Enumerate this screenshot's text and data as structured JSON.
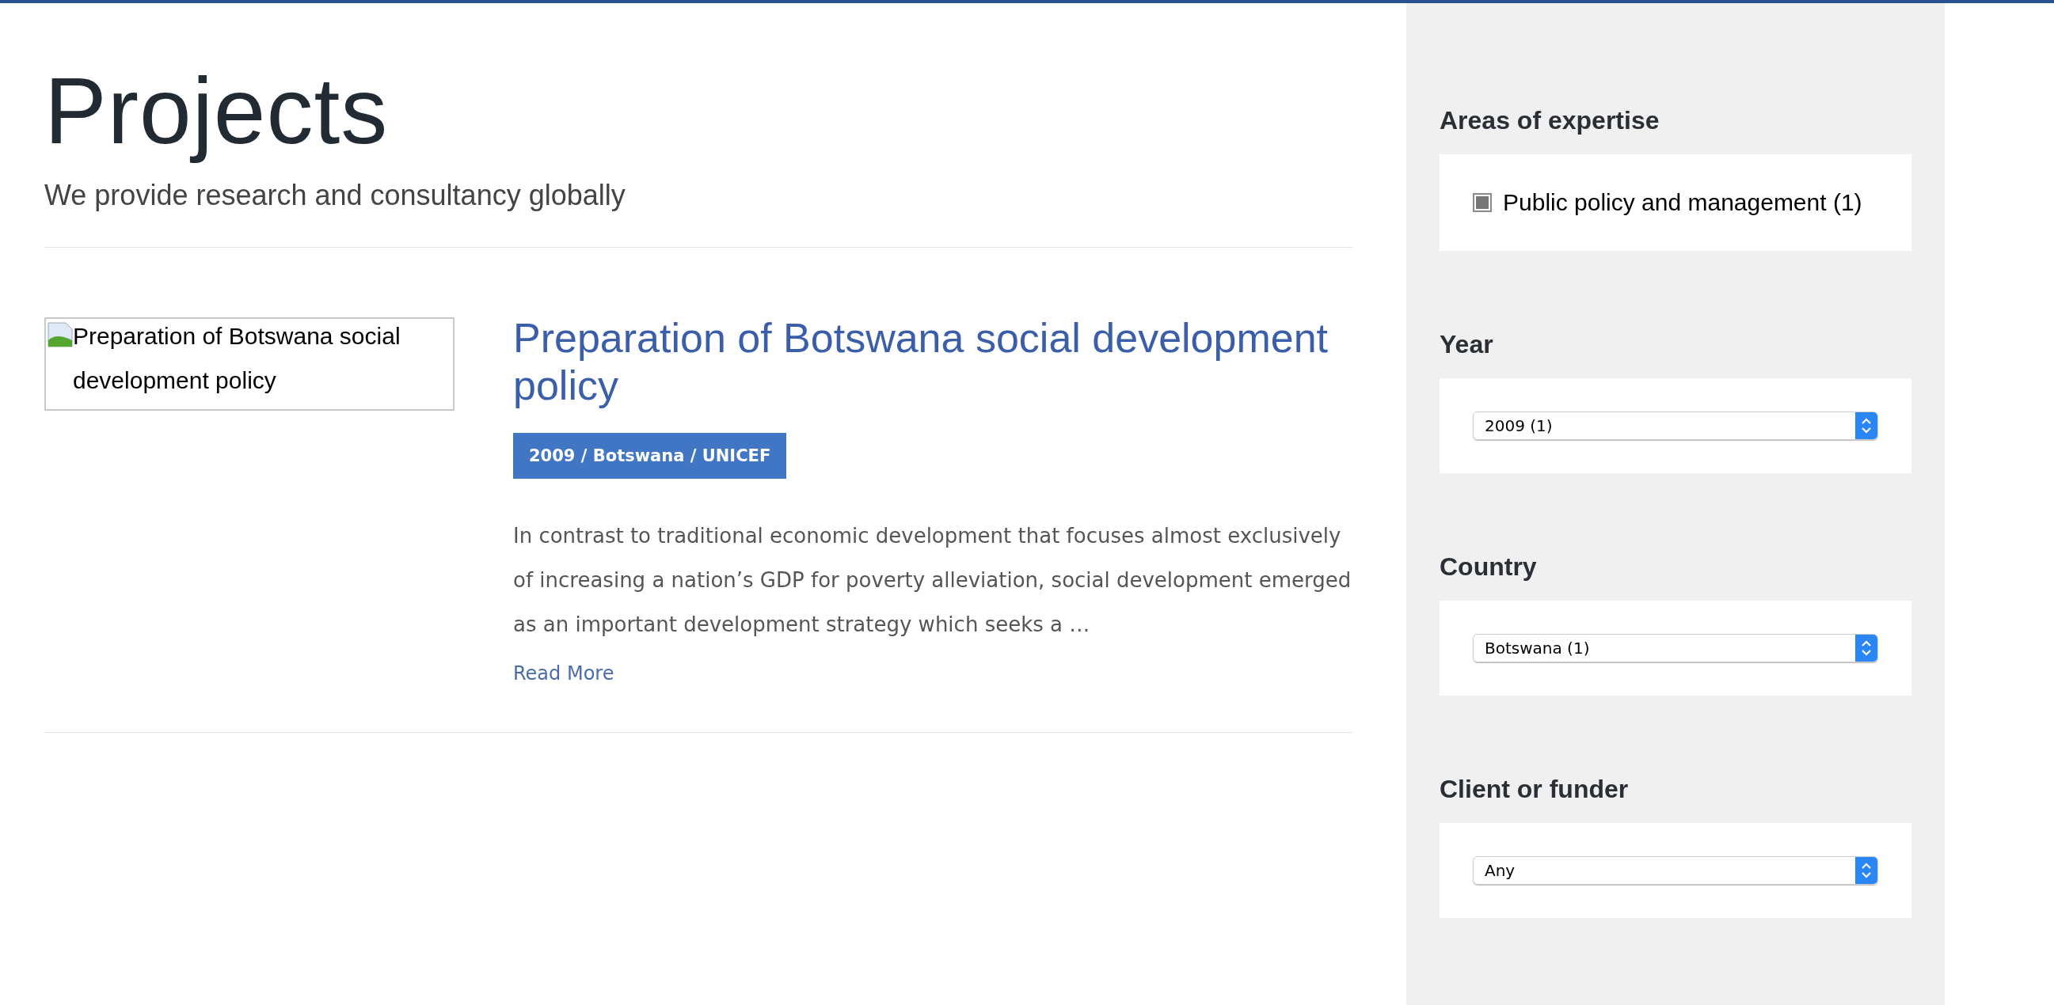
{
  "header": {
    "title": "Projects",
    "subtitle": "We provide research and consultancy globally"
  },
  "projects": [
    {
      "image_alt": "Preparation of Botswana social development policy",
      "title": "Preparation of Botswana social development policy",
      "tag": "2009 / Botswana / UNICEF",
      "excerpt": "In contrast to traditional economic development that focuses almost exclusively of increasing a nation’s GDP for poverty alleviation, social development emerged as an important development strategy which seeks a …",
      "read_more": "Read More"
    }
  ],
  "filters": [
    {
      "kind": "checkboxes",
      "heading": "Areas of expertise",
      "options": [
        {
          "label": "Public policy and management (1)",
          "checked": true
        }
      ]
    },
    {
      "kind": "select",
      "heading": "Year",
      "value": "2009 (1)"
    },
    {
      "kind": "select",
      "heading": "Country",
      "value": "Botswana (1)"
    },
    {
      "kind": "select",
      "heading": "Client or funder",
      "value": "Any"
    }
  ]
}
